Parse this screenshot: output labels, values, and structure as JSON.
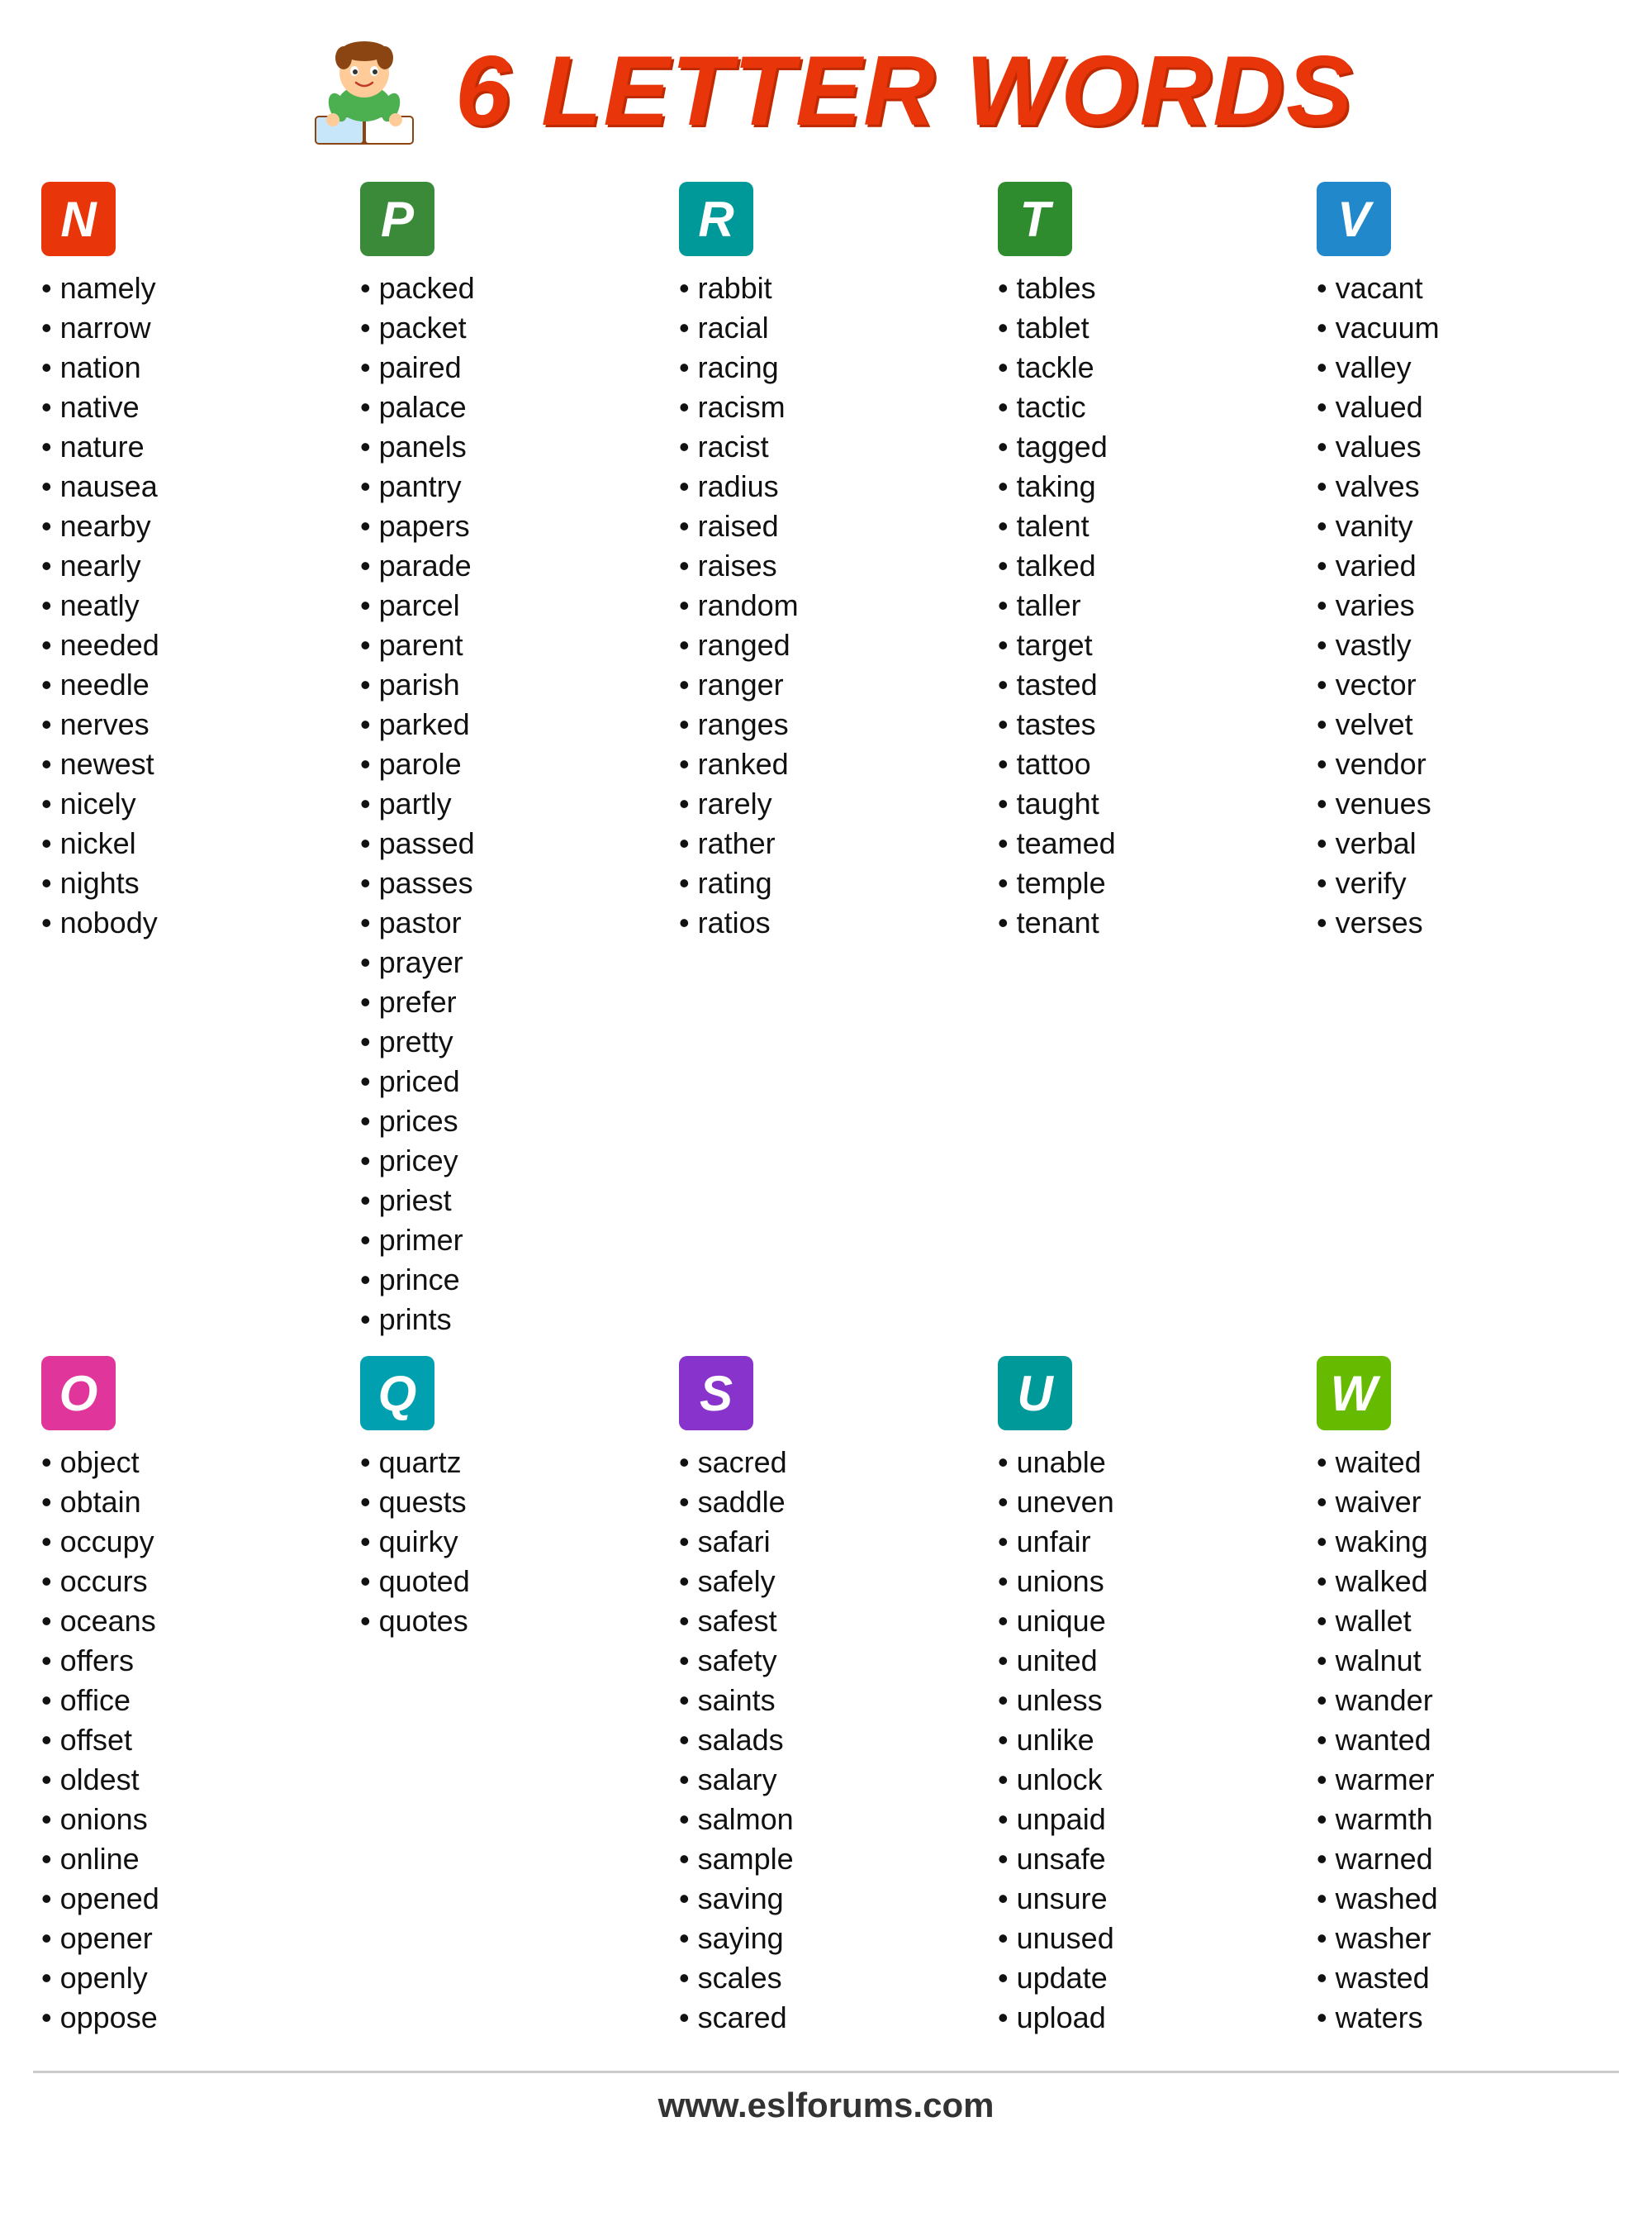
{
  "header": {
    "title": "6 LETTER WORDS",
    "url": "www.eslforums.com"
  },
  "columns": [
    {
      "letter": "N",
      "badge_class": "badge-red",
      "words": [
        "namely",
        "narrow",
        "nation",
        "native",
        "nature",
        "nausea",
        "nearby",
        "nearly",
        "neatly",
        "needed",
        "needle",
        "nerves",
        "newest",
        "nicely",
        "nickel",
        "nights",
        "nobody"
      ]
    },
    {
      "letter": "P",
      "badge_class": "badge-green",
      "words": [
        "packed",
        "packet",
        "paired",
        "palace",
        "panels",
        "pantry",
        "papers",
        "parade",
        "parcel",
        "parent",
        "parish",
        "parked",
        "parole",
        "partly",
        "passed",
        "passes",
        "pastor",
        "prayer",
        "prefer",
        "pretty",
        "priced",
        "prices",
        "pricey",
        "priest",
        "primer",
        "prince",
        "prints"
      ]
    },
    {
      "letter": "R",
      "badge_class": "badge-teal",
      "words": [
        "rabbit",
        "racial",
        "racing",
        "racism",
        "racist",
        "radius",
        "raised",
        "raises",
        "random",
        "ranged",
        "ranger",
        "ranges",
        "ranked",
        "rarely",
        "rather",
        "rating",
        "ratios"
      ]
    },
    {
      "letter": "T",
      "badge_class": "badge-dark-green",
      "words": [
        "tables",
        "tablet",
        "tackle",
        "tactic",
        "tagged",
        "taking",
        "talent",
        "talked",
        "taller",
        "target",
        "tasted",
        "tastes",
        "tattoo",
        "taught",
        "teamed",
        "temple",
        "tenant"
      ]
    },
    {
      "letter": "V",
      "badge_class": "badge-blue",
      "words": [
        "vacant",
        "vacuum",
        "valley",
        "valued",
        "values",
        "valves",
        "vanity",
        "varied",
        "varies",
        "vastly",
        "vector",
        "velvet",
        "vendor",
        "venues",
        "verbal",
        "verify",
        "verses"
      ]
    },
    {
      "letter": "O",
      "badge_class": "badge-pink",
      "words": [
        "object",
        "obtain",
        "occupy",
        "occurs",
        "oceans",
        "offers",
        "office",
        "offset",
        "oldest",
        "onions",
        "online",
        "opened",
        "opener",
        "openly",
        "oppose"
      ]
    },
    {
      "letter": "Q",
      "badge_class": "badge-cyan",
      "words": [
        "quartz",
        "quests",
        "quirky",
        "quoted",
        "quotes"
      ]
    },
    {
      "letter": "S",
      "badge_class": "badge-purple",
      "words": [
        "sacred",
        "saddle",
        "safari",
        "safely",
        "safest",
        "safety",
        "saints",
        "salads",
        "salary",
        "salmon",
        "sample",
        "saving",
        "saying",
        "scales",
        "scared"
      ]
    },
    {
      "letter": "U",
      "badge_class": "badge-teal2",
      "words": [
        "unable",
        "uneven",
        "unfair",
        "unions",
        "unique",
        "united",
        "unless",
        "unlike",
        "unlock",
        "unpaid",
        "unsafe",
        "unsure",
        "unused",
        "update",
        "upload"
      ]
    },
    {
      "letter": "W",
      "badge_class": "badge-lime",
      "words": [
        "waited",
        "waiver",
        "waking",
        "walked",
        "wallet",
        "walnut",
        "wander",
        "wanted",
        "warmer",
        "warmth",
        "warned",
        "washed",
        "washer",
        "wasted",
        "waters"
      ]
    }
  ]
}
